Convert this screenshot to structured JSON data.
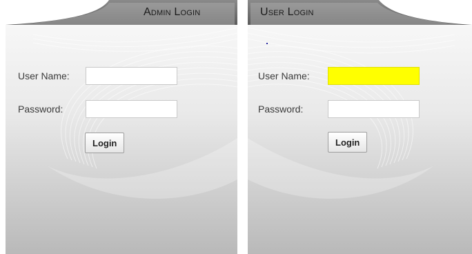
{
  "admin_panel": {
    "title": "Admin Login",
    "username_label": "User Name:",
    "username_value": "",
    "password_label": "Password:",
    "password_value": "",
    "login_label": "Login"
  },
  "user_panel": {
    "title": "User Login",
    "username_label": "User Name:",
    "username_value": "",
    "password_label": "Password:",
    "password_value": "",
    "login_label": "Login",
    "focused_field_color": "#ffff00"
  },
  "colors": {
    "panel_header": "#6e6e6e",
    "panel_body_top": "#f7f7f7",
    "panel_body_bottom": "#bdbdbd"
  }
}
